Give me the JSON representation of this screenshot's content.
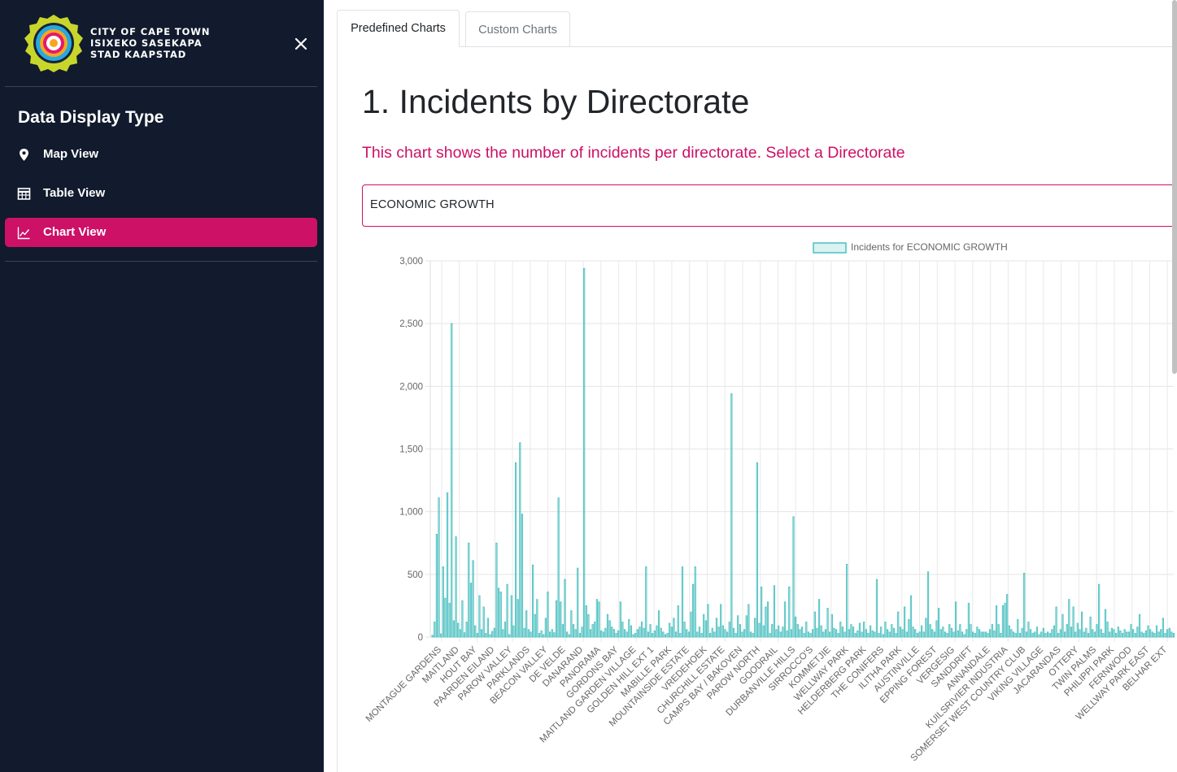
{
  "sidebar": {
    "city_lines": [
      "CITY OF CAPE TOWN",
      "ISIXEKO SASEKAPA",
      "STAD KAAPSTAD"
    ],
    "heading": "Data Display Type",
    "items": [
      {
        "label": "Map View",
        "icon": "map-marker-icon",
        "active": false
      },
      {
        "label": "Table View",
        "icon": "table-icon",
        "active": false
      },
      {
        "label": "Chart View",
        "icon": "line-chart-icon",
        "active": true
      }
    ],
    "colors": {
      "background": "#111b2d",
      "accent": "#cc1167"
    }
  },
  "tabs": [
    {
      "label": "Predefined Charts",
      "active": true
    },
    {
      "label": "Custom Charts",
      "active": false
    }
  ],
  "content": {
    "title": "1. Incidents by Directorate",
    "description": "This chart shows the number of incidents per directorate. Select a Directorate",
    "selected_directorate": "ECONOMIC GROWTH"
  },
  "chart_data": {
    "type": "bar",
    "legend": "Incidents for ECONOMIC GROWTH",
    "legend_position": "top",
    "grid": true,
    "bar_color": "#4bc0c0",
    "yticks": [
      "0",
      "500",
      "1,000",
      "1,500",
      "2,000",
      "2,500",
      "3,000"
    ],
    "ylim": [
      0,
      3000
    ],
    "categories": [
      "MONTAGUE GARDENS",
      "MAITLAND",
      "HOUT BAY",
      "PAARDEN EILAND",
      "PAROW VALLEY",
      "PARKLANDS",
      "BEACON VALLEY",
      "DE VELDE",
      "DANARAND",
      "PANORAMA",
      "GORDONS BAY",
      "MAITLAND GARDEN VILLAGE",
      "GOLDEN HILL EXT 1",
      "MABILLE PARK",
      "MOUNTAINSIDE ESTATE",
      "VREDEHOEK",
      "CHURCHILL ESTATE",
      "CAMPS BAY / BAKOVEN",
      "PAROW NORTH",
      "GOODRAIL",
      "DURBANVILLE HILLS",
      "SIRROCCO'S",
      "KOMMETJIE",
      "WELLWAY PARK",
      "HELDERBERG PARK",
      "THE CONIFERS",
      "ILITHA PARK",
      "AUSTINVILLE",
      "EPPING FOREST",
      "VERGESIG",
      "SANDDRIFT",
      "ANNANDALE",
      "KUILSRIVIER INDUSTRIA",
      "SOMERSET WEST COUNTRY CLUB",
      "VIKING VILLAGE",
      "JACARANDAS",
      "OTTERY",
      "TWIN PALMS",
      "PHILIPPI PARK",
      "FERNWOOD",
      "WELLWAY PARK EAST",
      "BELHAR EXT"
    ],
    "values": [
      15,
      120,
      820,
      1110,
      25,
      560,
      310,
      1150,
      270,
      2500,
      130,
      800,
      110,
      60,
      290,
      35,
      120,
      750,
      430,
      610,
      90,
      30,
      330,
      60,
      240,
      30,
      150,
      20,
      45,
      70,
      750,
      390,
      360,
      60,
      120,
      420,
      20,
      330,
      90,
      1390,
      300,
      1550,
      980,
      70,
      210,
      60,
      40,
      575,
      180,
      300,
      30,
      50,
      20,
      150,
      360,
      40,
      60,
      35,
      290,
      1110,
      280,
      100,
      460,
      40,
      20,
      210,
      100,
      60,
      550,
      30,
      80,
      2940,
      250,
      180,
      60,
      100,
      120,
      300,
      280,
      50,
      40,
      70,
      180,
      130,
      80,
      60,
      30,
      50,
      280,
      120,
      60,
      40,
      140,
      90,
      20,
      30,
      60,
      80,
      120,
      70,
      560,
      40,
      100,
      30,
      50,
      90,
      210,
      70,
      40,
      20,
      30,
      110,
      80,
      150,
      40,
      250,
      30,
      560,
      120,
      60,
      40,
      200,
      420,
      560,
      40,
      80,
      30,
      180,
      130,
      260,
      30,
      70,
      40,
      150,
      80,
      260,
      90,
      60,
      40,
      120,
      1940,
      70,
      30,
      170,
      100,
      40,
      60,
      170,
      260,
      40,
      30,
      150,
      1390,
      110,
      400,
      90,
      240,
      280,
      30,
      100,
      410,
      60,
      90,
      40,
      80,
      280,
      50,
      400,
      60,
      960,
      160,
      100,
      60,
      80,
      30,
      120,
      40,
      30,
      60,
      200,
      70,
      300,
      90,
      40,
      60,
      230,
      40,
      180,
      70,
      60,
      30,
      120,
      80,
      40,
      580,
      60,
      100,
      80,
      30,
      50,
      110,
      40,
      120,
      60,
      30,
      90,
      50,
      40,
      460,
      30,
      80,
      20,
      120,
      60,
      40,
      100,
      70,
      30,
      200,
      80,
      60,
      240,
      40,
      140,
      330,
      80,
      60,
      30,
      40,
      90,
      40,
      150,
      520,
      100,
      60,
      40,
      130,
      230,
      60,
      80,
      40,
      30,
      100,
      70,
      40,
      280,
      50,
      100,
      40,
      20,
      60,
      270,
      100,
      40,
      30,
      80,
      60,
      40,
      40,
      40,
      30,
      60,
      100,
      50,
      250,
      100,
      30,
      250,
      270,
      340,
      90,
      60,
      40,
      30,
      140,
      30,
      70,
      510,
      40,
      120,
      60,
      30,
      40,
      80,
      20,
      40,
      70,
      30,
      40,
      30,
      60,
      90,
      240,
      30,
      60,
      180,
      40,
      100,
      300,
      80,
      240,
      40,
      110,
      60,
      200,
      40,
      70,
      30,
      160,
      60,
      40,
      100,
      420,
      60,
      30,
      220,
      120,
      40,
      70,
      60,
      30,
      80,
      50,
      30,
      60,
      40,
      40,
      100,
      60,
      30,
      80,
      180,
      40,
      30,
      50,
      90,
      60,
      40,
      30,
      90,
      40,
      60,
      150,
      30,
      60,
      70,
      40,
      30
    ],
    "xlabel": "",
    "ylabel": ""
  }
}
